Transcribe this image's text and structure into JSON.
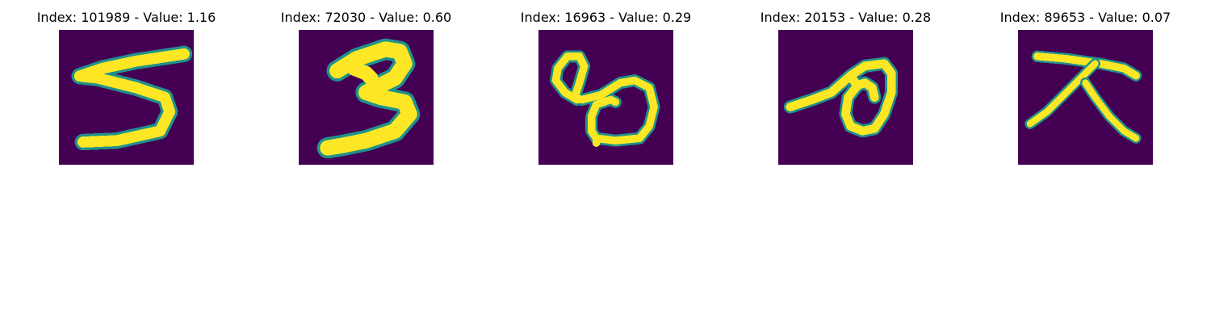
{
  "figure": {
    "panels": [
      {
        "title": "Index: 101989 - Value: 1.16",
        "digit": "5"
      },
      {
        "title": "Index: 72030 - Value: 0.60",
        "digit": "3"
      },
      {
        "title": "Index: 16963 - Value: 0.29",
        "digit": "8"
      },
      {
        "title": "Index: 20153 - Value: 0.28",
        "digit": "0"
      },
      {
        "title": "Index: 89653 - Value: 0.07",
        "digit": "7"
      }
    ]
  },
  "colors": {
    "background": "#440154",
    "stroke": "#fde725",
    "edge": "#21918c",
    "mid_edge": "#5ec962"
  }
}
